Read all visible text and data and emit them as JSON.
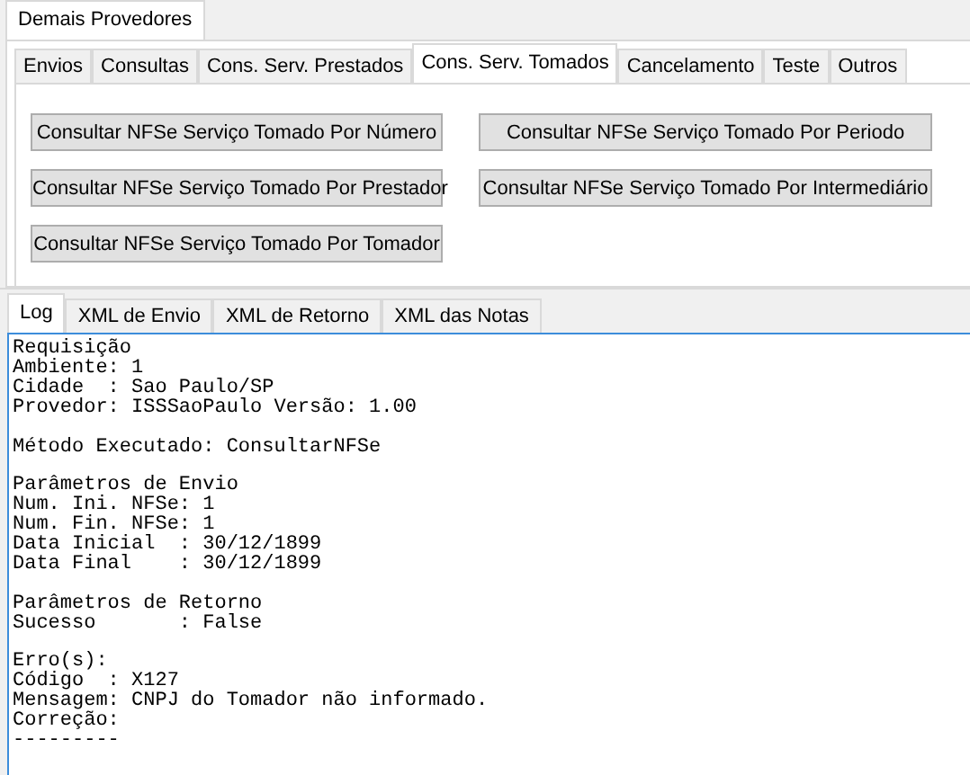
{
  "outer_tabs": [
    {
      "label": "Demais Provedores",
      "selected": true
    }
  ],
  "tabs": [
    {
      "label": "Envios",
      "selected": false
    },
    {
      "label": "Consultas",
      "selected": false
    },
    {
      "label": "Cons. Serv. Prestados",
      "selected": false
    },
    {
      "label": "Cons. Serv. Tomados",
      "selected": true
    },
    {
      "label": "Cancelamento",
      "selected": false
    },
    {
      "label": "Teste",
      "selected": false
    },
    {
      "label": "Outros",
      "selected": false
    }
  ],
  "buttons": [
    "Consultar NFSe Serviço Tomado Por Número",
    "Consultar NFSe Serviço Tomado Por Periodo",
    "Consultar NFSe Serviço Tomado Por Prestador",
    "Consultar NFSe Serviço Tomado Por Intermediário",
    "Consultar NFSe Serviço Tomado Por Tomador"
  ],
  "log_tabs": [
    {
      "label": "Log",
      "selected": true
    },
    {
      "label": "XML de Envio",
      "selected": false
    },
    {
      "label": "XML de Retorno",
      "selected": false
    },
    {
      "label": "XML das Notas",
      "selected": false
    }
  ],
  "log": [
    [
      "Requisição",
      "Ambiente: 1",
      "Cidade  : Sao Paulo/SP",
      "Provedor: ISSSaoPaulo Versão: 1.00"
    ],
    [
      "Método Executado: ConsultarNFSe"
    ],
    [
      "Parâmetros de Envio",
      "Num. Ini. NFSe: 1",
      "Num. Fin. NFSe: 1",
      "Data Inicial  : 30/12/1899",
      "Data Final    : 30/12/1899"
    ],
    [
      "Parâmetros de Retorno",
      "Sucesso       : False"
    ],
    [
      "Erro(s):",
      "Código  : X127",
      "Mensagem: CNPJ do Tomador não informado.",
      "Correção:",
      "---------"
    ]
  ]
}
